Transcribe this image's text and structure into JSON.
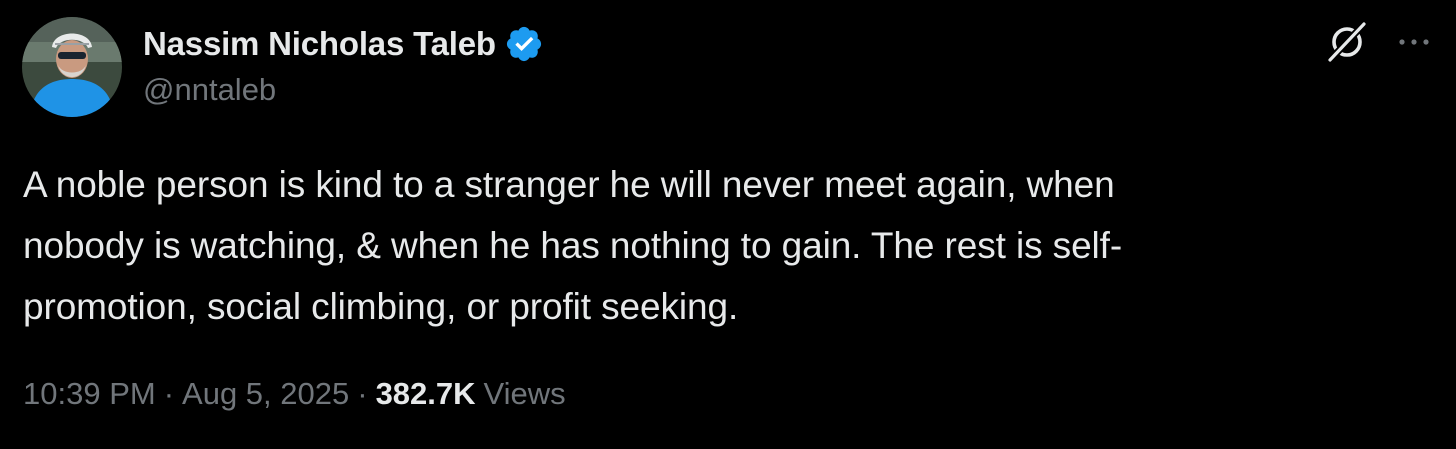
{
  "author": {
    "display_name": "Nassim Nicholas Taleb",
    "handle": "@nntaleb",
    "verified": true,
    "verified_badge_color": "#1d9bf0"
  },
  "header_actions": {
    "grok_icon": "grok-icon",
    "more_icon": "more-icon"
  },
  "tweet": {
    "text_lines": [
      "A noble person is kind to a stranger he will never meet again, when",
      "nobody is watching, & when he has nothing to gain. The rest is self-",
      "promotion, social climbing, or profit seeking."
    ]
  },
  "meta": {
    "time": "10:39 PM",
    "separator": "·",
    "date": "Aug 5, 2025",
    "views_count": "382.7K",
    "views_label": "Views"
  },
  "colors": {
    "background": "#000000",
    "primary_text": "#e7e9ea",
    "secondary_text": "#71767b",
    "accent": "#1d9bf0"
  }
}
